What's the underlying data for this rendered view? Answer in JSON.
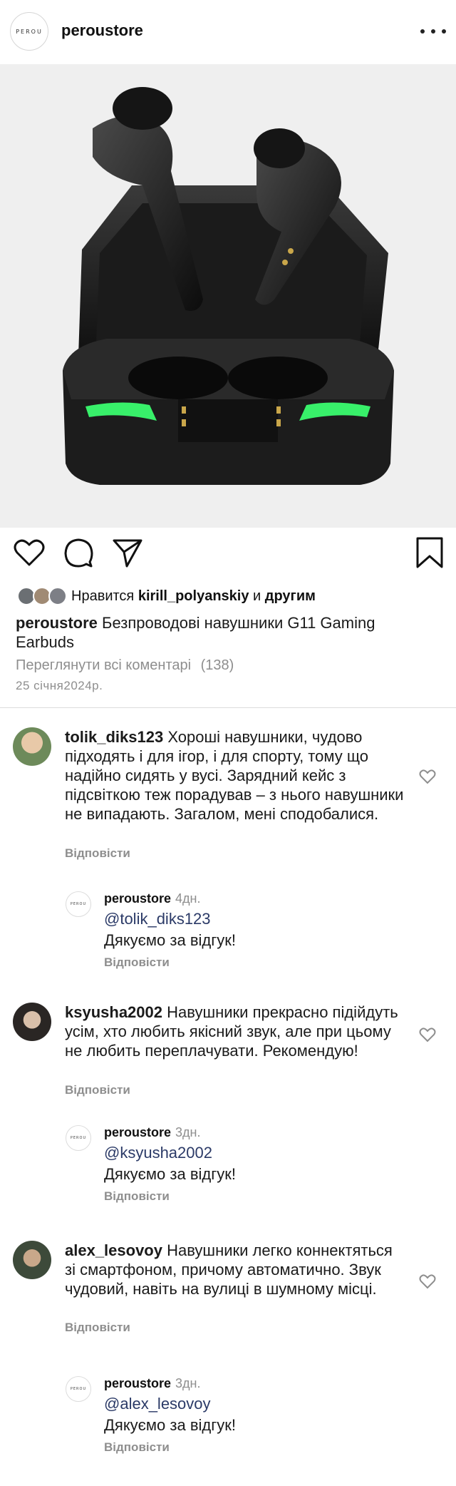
{
  "header": {
    "logo_text": "PEROU",
    "username": "peroustore",
    "more_icon": "more-icon"
  },
  "post": {
    "image_alt_icon": "earbuds-product-photo",
    "likes": {
      "prefix": "Нравится",
      "user": "kirill_polyanskiy",
      "middle": "и",
      "suffix": "другим"
    },
    "caption": {
      "user": "peroustore",
      "text": "Безпроводові навушники G11 Gaming Earbuds"
    },
    "view_all_comments": "Переглянути всі коментарі",
    "comments_count": "(138)",
    "date": "25 січня2024р."
  },
  "comments": [
    {
      "user": "tolik_diks123",
      "text": "Хороші навушники, чудово підходять і для ігор, і для спорту, тому що надійно сидять у вусі. Зарядний кейс з підсвіткою теж порадував – з нього навушники не випадають. Загалом, мені сподобалися.",
      "reply_label": "Відповісти",
      "reply": {
        "user": "peroustore",
        "time": "4дн.",
        "mention": "@tolik_diks123",
        "text": "Дякуємо за відгук!",
        "reply_label": "Відповісти"
      }
    },
    {
      "user": "ksyusha2002",
      "text": "Навушники прекрасно підійдуть усім, хто любить якісний звук, але при цьому не любить переплачувати. Рекомендую!",
      "reply_label": "Відповісти",
      "reply": {
        "user": "peroustore",
        "time": "3дн.",
        "mention": "@ksyusha2002",
        "text": "Дякуємо за відгук!",
        "reply_label": "Відповісти"
      }
    },
    {
      "user": "alex_lesovoy",
      "text": "Навушники легко коннектяться зі смартфоном, причому автоматично. Звук чудовий, навіть на вулиці в шумному місці.",
      "reply_label": "Відповісти",
      "reply": {
        "user": "peroustore",
        "time": "3дн.",
        "mention": "@alex_lesovoy",
        "text": "Дякуємо за відгук!",
        "reply_label": "Відповісти"
      }
    }
  ],
  "colors": {
    "accent_glow": "#38f06a",
    "muted_text": "#8e8e8e",
    "mention": "#2b3a67"
  }
}
